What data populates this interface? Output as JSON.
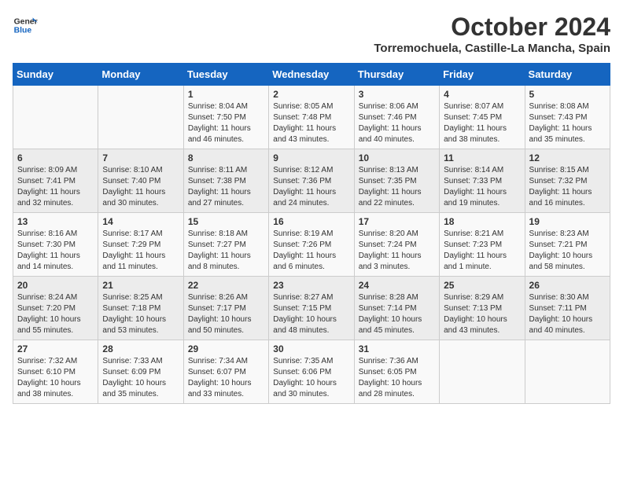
{
  "header": {
    "logo_general": "General",
    "logo_blue": "Blue",
    "month_title": "October 2024",
    "location": "Torremochuela, Castille-La Mancha, Spain"
  },
  "days_of_week": [
    "Sunday",
    "Monday",
    "Tuesday",
    "Wednesday",
    "Thursday",
    "Friday",
    "Saturday"
  ],
  "weeks": [
    [
      {
        "day": "",
        "info": ""
      },
      {
        "day": "",
        "info": ""
      },
      {
        "day": "1",
        "info": "Sunrise: 8:04 AM\nSunset: 7:50 PM\nDaylight: 11 hours and 46 minutes."
      },
      {
        "day": "2",
        "info": "Sunrise: 8:05 AM\nSunset: 7:48 PM\nDaylight: 11 hours and 43 minutes."
      },
      {
        "day": "3",
        "info": "Sunrise: 8:06 AM\nSunset: 7:46 PM\nDaylight: 11 hours and 40 minutes."
      },
      {
        "day": "4",
        "info": "Sunrise: 8:07 AM\nSunset: 7:45 PM\nDaylight: 11 hours and 38 minutes."
      },
      {
        "day": "5",
        "info": "Sunrise: 8:08 AM\nSunset: 7:43 PM\nDaylight: 11 hours and 35 minutes."
      }
    ],
    [
      {
        "day": "6",
        "info": "Sunrise: 8:09 AM\nSunset: 7:41 PM\nDaylight: 11 hours and 32 minutes."
      },
      {
        "day": "7",
        "info": "Sunrise: 8:10 AM\nSunset: 7:40 PM\nDaylight: 11 hours and 30 minutes."
      },
      {
        "day": "8",
        "info": "Sunrise: 8:11 AM\nSunset: 7:38 PM\nDaylight: 11 hours and 27 minutes."
      },
      {
        "day": "9",
        "info": "Sunrise: 8:12 AM\nSunset: 7:36 PM\nDaylight: 11 hours and 24 minutes."
      },
      {
        "day": "10",
        "info": "Sunrise: 8:13 AM\nSunset: 7:35 PM\nDaylight: 11 hours and 22 minutes."
      },
      {
        "day": "11",
        "info": "Sunrise: 8:14 AM\nSunset: 7:33 PM\nDaylight: 11 hours and 19 minutes."
      },
      {
        "day": "12",
        "info": "Sunrise: 8:15 AM\nSunset: 7:32 PM\nDaylight: 11 hours and 16 minutes."
      }
    ],
    [
      {
        "day": "13",
        "info": "Sunrise: 8:16 AM\nSunset: 7:30 PM\nDaylight: 11 hours and 14 minutes."
      },
      {
        "day": "14",
        "info": "Sunrise: 8:17 AM\nSunset: 7:29 PM\nDaylight: 11 hours and 11 minutes."
      },
      {
        "day": "15",
        "info": "Sunrise: 8:18 AM\nSunset: 7:27 PM\nDaylight: 11 hours and 8 minutes."
      },
      {
        "day": "16",
        "info": "Sunrise: 8:19 AM\nSunset: 7:26 PM\nDaylight: 11 hours and 6 minutes."
      },
      {
        "day": "17",
        "info": "Sunrise: 8:20 AM\nSunset: 7:24 PM\nDaylight: 11 hours and 3 minutes."
      },
      {
        "day": "18",
        "info": "Sunrise: 8:21 AM\nSunset: 7:23 PM\nDaylight: 11 hours and 1 minute."
      },
      {
        "day": "19",
        "info": "Sunrise: 8:23 AM\nSunset: 7:21 PM\nDaylight: 10 hours and 58 minutes."
      }
    ],
    [
      {
        "day": "20",
        "info": "Sunrise: 8:24 AM\nSunset: 7:20 PM\nDaylight: 10 hours and 55 minutes."
      },
      {
        "day": "21",
        "info": "Sunrise: 8:25 AM\nSunset: 7:18 PM\nDaylight: 10 hours and 53 minutes."
      },
      {
        "day": "22",
        "info": "Sunrise: 8:26 AM\nSunset: 7:17 PM\nDaylight: 10 hours and 50 minutes."
      },
      {
        "day": "23",
        "info": "Sunrise: 8:27 AM\nSunset: 7:15 PM\nDaylight: 10 hours and 48 minutes."
      },
      {
        "day": "24",
        "info": "Sunrise: 8:28 AM\nSunset: 7:14 PM\nDaylight: 10 hours and 45 minutes."
      },
      {
        "day": "25",
        "info": "Sunrise: 8:29 AM\nSunset: 7:13 PM\nDaylight: 10 hours and 43 minutes."
      },
      {
        "day": "26",
        "info": "Sunrise: 8:30 AM\nSunset: 7:11 PM\nDaylight: 10 hours and 40 minutes."
      }
    ],
    [
      {
        "day": "27",
        "info": "Sunrise: 7:32 AM\nSunset: 6:10 PM\nDaylight: 10 hours and 38 minutes."
      },
      {
        "day": "28",
        "info": "Sunrise: 7:33 AM\nSunset: 6:09 PM\nDaylight: 10 hours and 35 minutes."
      },
      {
        "day": "29",
        "info": "Sunrise: 7:34 AM\nSunset: 6:07 PM\nDaylight: 10 hours and 33 minutes."
      },
      {
        "day": "30",
        "info": "Sunrise: 7:35 AM\nSunset: 6:06 PM\nDaylight: 10 hours and 30 minutes."
      },
      {
        "day": "31",
        "info": "Sunrise: 7:36 AM\nSunset: 6:05 PM\nDaylight: 10 hours and 28 minutes."
      },
      {
        "day": "",
        "info": ""
      },
      {
        "day": "",
        "info": ""
      }
    ]
  ]
}
